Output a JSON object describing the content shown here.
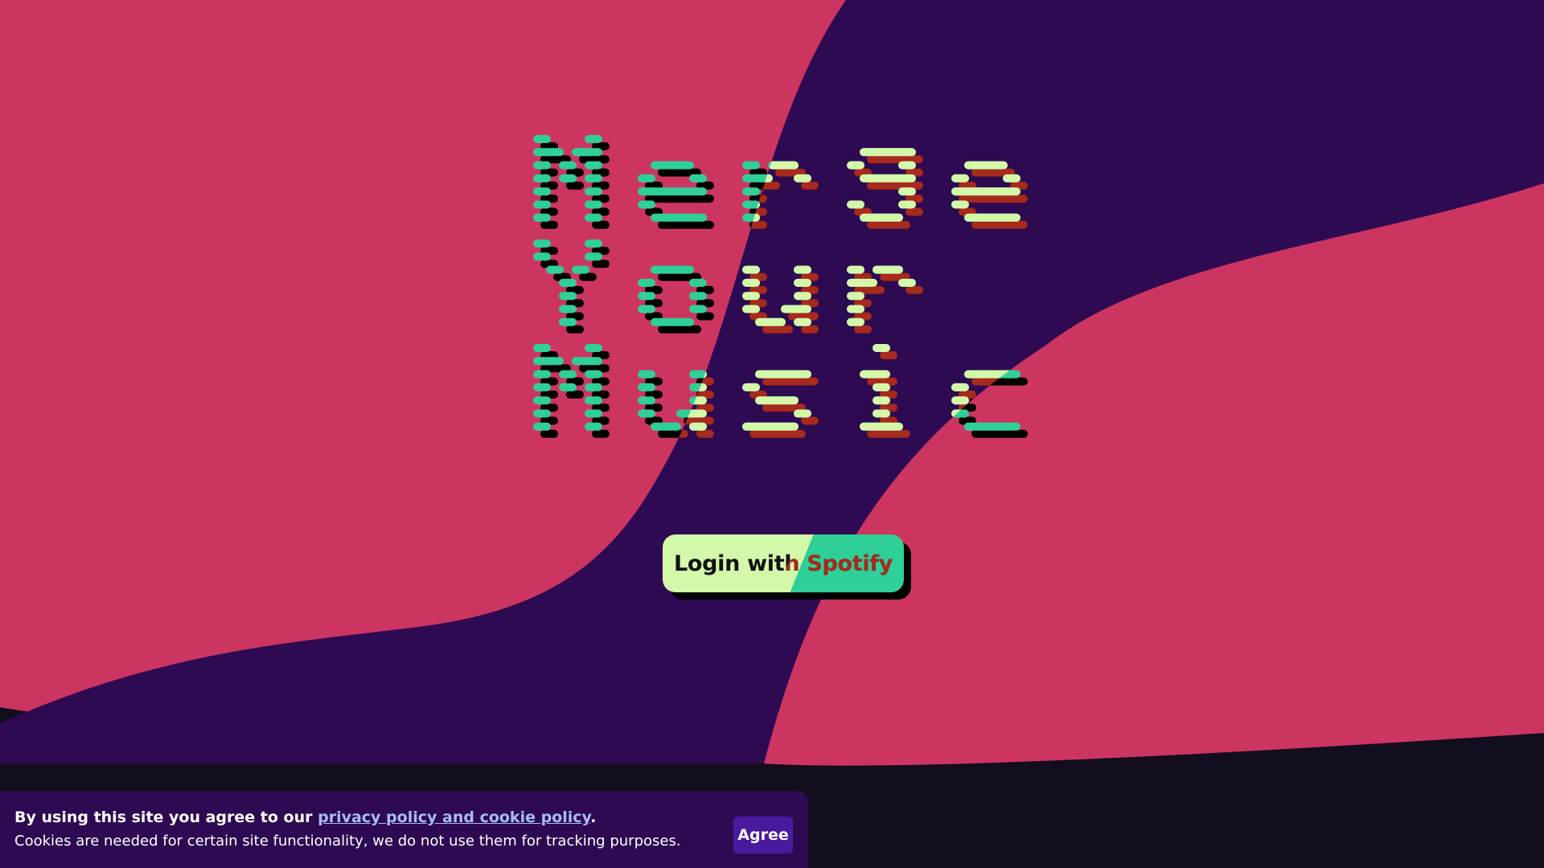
{
  "colors": {
    "pink": "#cd3561",
    "purple": "#2e0a52",
    "dark": "#130e1e",
    "green": "#2fcf98",
    "lime": "#d4f8a9",
    "red": "#a62a1d",
    "black": "#000000"
  },
  "hero": {
    "title_lines": [
      "Merge",
      "Your",
      "Music"
    ]
  },
  "login": {
    "label": "Login with Spotify"
  },
  "cookie": {
    "text_before": "By using this site you agree to our ",
    "link_text": "privacy policy and cookie policy",
    "text_after": ".",
    "detail": "Cookies are needed for certain site functionality, we do not use them for tracking purposes.",
    "agree_label": "Agree"
  }
}
